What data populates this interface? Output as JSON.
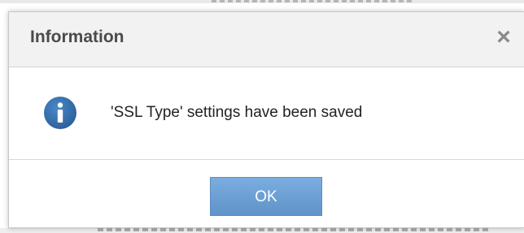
{
  "dialog": {
    "title": "Information",
    "close_glyph": "×",
    "icon": "info-icon",
    "message": "'SSL Type' settings have been saved",
    "ok_label": "OK"
  },
  "colors": {
    "header_bg": "#f2f2f2",
    "icon_blue": "#2f6fad",
    "button_blue": "#6a9fd4",
    "button_text": "#ffffff"
  }
}
